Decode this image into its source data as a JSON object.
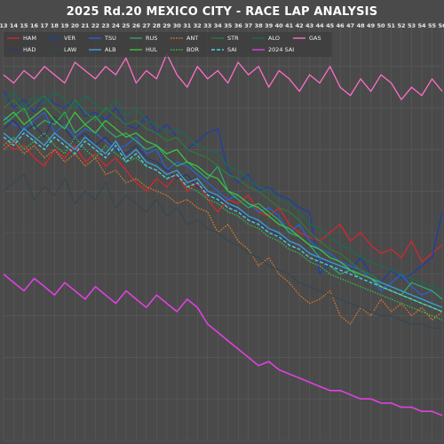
{
  "chart_data": {
    "type": "line",
    "title": "2025 Rd.20 MEXICO CITY - RACE LAP ANALYSIS",
    "xlabel": "",
    "ylabel": "",
    "grid": true,
    "legend_position": "top-left",
    "x": [
      13,
      14,
      15,
      16,
      17,
      18,
      19,
      20,
      21,
      22,
      23,
      24,
      25,
      26,
      27,
      28,
      29,
      30,
      31,
      32,
      33,
      34,
      35,
      36,
      37,
      38,
      39,
      40,
      41,
      42,
      43,
      44,
      45,
      46,
      47,
      48,
      49,
      50,
      51,
      52,
      53,
      54,
      55,
      56
    ],
    "x_tick_labels": [
      "13",
      "14",
      "15",
      "16",
      "17",
      "18",
      "19",
      "20",
      "21",
      "22",
      "23",
      "24",
      "25",
      "26",
      "27",
      "28",
      "29",
      "30",
      "31",
      "32",
      "33",
      "34",
      "35",
      "36",
      "37",
      "38",
      "39",
      "40",
      "41",
      "42",
      "43",
      "44",
      "45",
      "46",
      "47",
      "48",
      "49",
      "50",
      "51",
      "52",
      "53",
      "54",
      "55",
      "56"
    ],
    "ylim": [
      0,
      100
    ],
    "series": [
      {
        "name": "HAM",
        "color": "#d0282e",
        "dash": "solid",
        "values": [
          72,
          70,
          71,
          68,
          66,
          70,
          68,
          71,
          67,
          69,
          66,
          68,
          65,
          62,
          60,
          63,
          61,
          64,
          60,
          62,
          58,
          55,
          58,
          57,
          59,
          55,
          54,
          56,
          52,
          50,
          49,
          48,
          50,
          52,
          48,
          50,
          47,
          45,
          46,
          44,
          48,
          43,
          45,
          47
        ]
      },
      {
        "name": "VER",
        "color": "#1e3fa8",
        "dash": "solid",
        "values": [
          84,
          80,
          82,
          79,
          83,
          81,
          80,
          82,
          78,
          79,
          77,
          80,
          76,
          75,
          78,
          74,
          76,
          73,
          70,
          72,
          74,
          75,
          65,
          62,
          64,
          60,
          61,
          59,
          58,
          56,
          55,
          40,
          43,
          42,
          41,
          44,
          40,
          38,
          41,
          39,
          40,
          42,
          44,
          55
        ]
      },
      {
        "name": "TSU",
        "color": "#2a5fd6",
        "dash": "solid",
        "values": [
          78,
          76,
          75,
          77,
          79,
          74,
          76,
          73,
          75,
          74,
          72,
          70,
          71,
          73,
          69,
          70,
          65,
          67,
          66,
          64,
          62,
          60,
          58,
          59,
          57,
          55,
          56,
          54,
          50,
          52,
          48,
          46,
          45,
          43,
          42,
          41,
          39,
          36,
          38,
          40,
          37,
          35,
          36,
          34
        ]
      },
      {
        "name": "RUS",
        "color": "#2ea86a",
        "dash": "solid",
        "values": [
          76,
          78,
          80,
          75,
          77,
          76,
          79,
          74,
          76,
          78,
          75,
          73,
          74,
          72,
          70,
          71,
          68,
          66,
          67,
          65,
          63,
          66,
          60,
          58,
          56,
          57,
          55,
          53,
          50,
          49,
          47,
          44,
          42,
          40,
          41,
          39,
          38,
          37,
          36,
          35,
          38,
          37,
          36,
          34
        ]
      },
      {
        "name": "ANT",
        "color": "#e0782a",
        "dash": "dotted",
        "values": [
          70,
          72,
          69,
          71,
          68,
          70,
          67,
          69,
          66,
          68,
          64,
          65,
          62,
          63,
          61,
          60,
          59,
          57,
          58,
          56,
          55,
          50,
          52,
          48,
          46,
          42,
          44,
          40,
          38,
          35,
          33,
          34,
          36,
          30,
          28,
          32,
          30,
          34,
          31,
          33,
          30,
          32,
          29,
          31
        ]
      },
      {
        "name": "STR",
        "color": "#2b7a3a",
        "dash": "solid",
        "values": [
          80,
          82,
          79,
          81,
          83,
          80,
          78,
          82,
          79,
          77,
          80,
          78,
          76,
          77,
          75,
          74,
          72,
          73,
          70,
          69,
          68,
          66,
          64,
          63,
          61,
          60,
          58,
          56,
          55,
          53,
          50,
          48,
          46,
          45,
          43,
          41,
          40,
          38,
          37,
          36,
          35,
          34,
          33,
          32
        ]
      },
      {
        "name": "ALO",
        "color": "#1a6b52",
        "dash": "solid",
        "values": [
          82,
          84,
          80,
          83,
          81,
          84,
          82,
          80,
          83,
          81,
          79,
          82,
          78,
          80,
          77,
          76,
          74,
          75,
          73,
          71,
          70,
          69,
          66,
          65,
          63,
          61,
          60,
          58,
          57,
          55,
          52,
          51,
          49,
          47,
          46,
          44,
          43,
          42,
          41,
          40,
          39,
          38,
          37,
          36
        ]
      },
      {
        "name": "GAS",
        "color": "#ff6ec7",
        "dash": "solid",
        "values": [
          88,
          86,
          89,
          87,
          90,
          88,
          86,
          91,
          89,
          87,
          90,
          88,
          92,
          86,
          89,
          87,
          93,
          88,
          85,
          90,
          87,
          89,
          86,
          91,
          88,
          90,
          85,
          89,
          87,
          84,
          88,
          86,
          90,
          85,
          83,
          87,
          84,
          88,
          86,
          82,
          85,
          83,
          87,
          84
        ]
      },
      {
        "name": "HAD",
        "color": "#2c3a6e",
        "dash": "solid",
        "values": [
          75,
          77,
          74,
          76,
          73,
          78,
          75,
          72,
          74,
          71,
          73,
          70,
          69,
          71,
          68,
          67,
          65,
          63,
          64,
          61,
          60,
          58,
          57,
          55,
          54,
          52,
          51,
          49,
          48,
          47,
          45,
          44,
          42,
          41,
          40,
          39,
          38,
          37,
          36,
          35,
          34,
          33,
          32,
          31
        ]
      },
      {
        "name": "LAW",
        "color": "#37474f",
        "dash": "solid",
        "values": [
          60,
          62,
          64,
          58,
          61,
          59,
          63,
          57,
          60,
          58,
          62,
          56,
          59,
          57,
          55,
          58,
          54,
          56,
          52,
          53,
          51,
          50,
          48,
          47,
          45,
          44,
          42,
          41,
          40,
          38,
          37,
          36,
          35,
          34,
          33,
          32,
          31,
          30,
          30,
          29,
          28,
          28,
          27,
          27
        ]
      },
      {
        "name": "ALB",
        "color": "#3aa0e0",
        "dash": "solid",
        "values": [
          74,
          72,
          75,
          73,
          71,
          74,
          72,
          70,
          73,
          71,
          69,
          72,
          68,
          70,
          67,
          66,
          64,
          65,
          62,
          63,
          60,
          59,
          57,
          56,
          54,
          53,
          51,
          50,
          48,
          47,
          45,
          44,
          43,
          42,
          41,
          40,
          39,
          38,
          37,
          36,
          35,
          34,
          33,
          32
        ]
      },
      {
        "name": "HUL",
        "color": "#3cc43c",
        "dash": "solid",
        "values": [
          77,
          79,
          76,
          78,
          80,
          77,
          75,
          79,
          76,
          74,
          77,
          75,
          73,
          74,
          72,
          71,
          69,
          70,
          67,
          66,
          64,
          63,
          60,
          59,
          57,
          56,
          54,
          52,
          51,
          49,
          47,
          46,
          44,
          43,
          41,
          40,
          39,
          37,
          36,
          35,
          34,
          33,
          32,
          31
        ]
      },
      {
        "name": "BOR",
        "color": "#2fbf4f",
        "dash": "dotted",
        "values": [
          71,
          73,
          70,
          72,
          74,
          71,
          69,
          73,
          70,
          68,
          71,
          69,
          67,
          68,
          66,
          65,
          63,
          64,
          61,
          60,
          58,
          57,
          55,
          54,
          52,
          51,
          49,
          48,
          46,
          45,
          43,
          42,
          40,
          39,
          38,
          37,
          36,
          35,
          34,
          33,
          32,
          31,
          30,
          29
        ]
      },
      {
        "name": "SAI",
        "color": "#4fd0e0",
        "dash": "dashed",
        "values": [
          73,
          71,
          74,
          72,
          70,
          73,
          71,
          69,
          72,
          70,
          68,
          71,
          67,
          69,
          66,
          65,
          63,
          64,
          61,
          62,
          59,
          58,
          56,
          55,
          53,
          52,
          50,
          49,
          47,
          46,
          44,
          43,
          42,
          41,
          40,
          39,
          38,
          37,
          36,
          35,
          34,
          33,
          32,
          31
        ]
      },
      {
        "name": "2024 SAI",
        "color": "#e040e0",
        "dash": "solid",
        "values": [
          40,
          38,
          36,
          39,
          37,
          35,
          38,
          36,
          34,
          37,
          35,
          33,
          36,
          34,
          32,
          35,
          33,
          31,
          34,
          32,
          28,
          26,
          24,
          22,
          20,
          18,
          19,
          17,
          16,
          15,
          14,
          13,
          12,
          12,
          11,
          10,
          10,
          9,
          9,
          8,
          8,
          7,
          7,
          6
        ]
      }
    ]
  }
}
